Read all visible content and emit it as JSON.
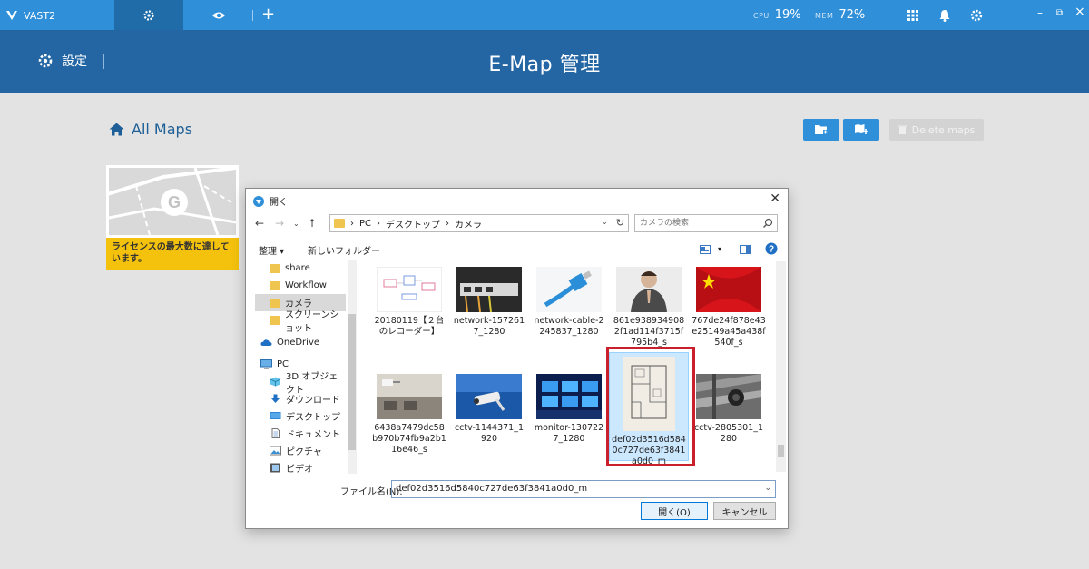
{
  "topbar": {
    "app_name": "VAST2",
    "cpu_label": "CPU",
    "cpu_value": "19%",
    "mem_label": "MEM",
    "mem_value": "72%",
    "add_label": "+"
  },
  "header": {
    "settings_label": "設定",
    "title": "E-Map 管理"
  },
  "content": {
    "all_maps_label": "All Maps",
    "delete_maps_label": "Delete maps",
    "license_warning": "ライセンスの最大数に達しています。",
    "map_placeholder_letter": "G"
  },
  "dialog": {
    "title": "開く",
    "address": {
      "parts": [
        "PC",
        "デスクトップ",
        "カメラ"
      ]
    },
    "search_placeholder": "カメラの検索",
    "organize_label": "整理 ▾",
    "new_folder_label": "新しいフォルダー",
    "tree": [
      {
        "label": "share",
        "icon": "folder-icon"
      },
      {
        "label": "Workflow",
        "icon": "folder-icon"
      },
      {
        "label": "カメラ",
        "icon": "folder-icon",
        "selected": true
      },
      {
        "label": "スクリーンショット",
        "icon": "folder-icon"
      },
      {
        "label": "OneDrive",
        "icon": "cloud-icon"
      },
      {
        "label": "PC",
        "icon": "computer-icon"
      },
      {
        "label": "3D オブジェクト",
        "icon": "cube-icon"
      },
      {
        "label": "ダウンロード",
        "icon": "download-icon"
      },
      {
        "label": "デスクトップ",
        "icon": "desktop-icon"
      },
      {
        "label": "ドキュメント",
        "icon": "document-icon"
      },
      {
        "label": "ピクチャ",
        "icon": "picture-icon"
      },
      {
        "label": "ビデオ",
        "icon": "video-icon"
      }
    ],
    "files": [
      {
        "name": "20180119【２台のレコーダー】"
      },
      {
        "name": "network-1572617_1280"
      },
      {
        "name": "network-cable-2245837_1280"
      },
      {
        "name": "861e9389349082f1ad114f3715f795b4_s"
      },
      {
        "name": "767de24f878e43e25149a45a438f540f_s"
      },
      {
        "name": "6438a7479dc58b970b74fb9a2b116e46_s"
      },
      {
        "name": "cctv-1144371_1920"
      },
      {
        "name": "monitor-1307227_1280"
      },
      {
        "name": "def02d3516d5840c727de63f3841a0d0_m",
        "selected": true
      },
      {
        "name": "cctv-2805301_1280"
      }
    ],
    "filename_label": "ファイル名(N):",
    "filename_value": "def02d3516d5840c727de63f3841a0d0_m",
    "open_label": "開く(O)",
    "cancel_label": "キャンセル"
  },
  "colors": {
    "topbar": "#2f8fd8",
    "header": "#2466a3",
    "warning": "#f4c20d",
    "highlight": "#c9202b"
  }
}
